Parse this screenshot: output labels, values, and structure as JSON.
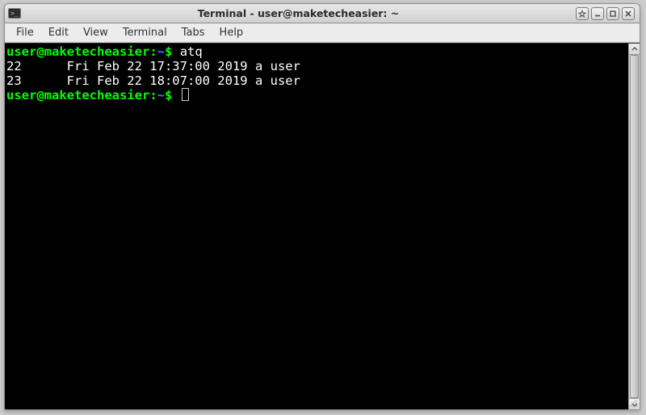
{
  "window": {
    "title": "Terminal - user@maketecheasier: ~"
  },
  "menu": {
    "items": [
      "File",
      "Edit",
      "View",
      "Terminal",
      "Tabs",
      "Help"
    ]
  },
  "prompt": {
    "user_host": "user@maketecheasier",
    "colon": ":",
    "path": "~",
    "sigil": "$"
  },
  "session": {
    "command": "atq",
    "output_lines": [
      "22      Fri Feb 22 17:37:00 2019 a user",
      "23      Fri Feb 22 18:07:00 2019 a user"
    ]
  },
  "colors": {
    "prompt_user": "#00ff00",
    "prompt_path": "#3b7bff",
    "term_bg": "#000000",
    "term_fg": "#ffffff"
  },
  "icons": {
    "app": "terminal-icon",
    "sticky": "sticky-icon",
    "minimize": "minimize-icon",
    "maximize": "maximize-icon",
    "close": "close-icon",
    "scroll_up": "chevron-up-icon",
    "scroll_down": "chevron-down-icon",
    "resize": "resize-grip-icon"
  }
}
